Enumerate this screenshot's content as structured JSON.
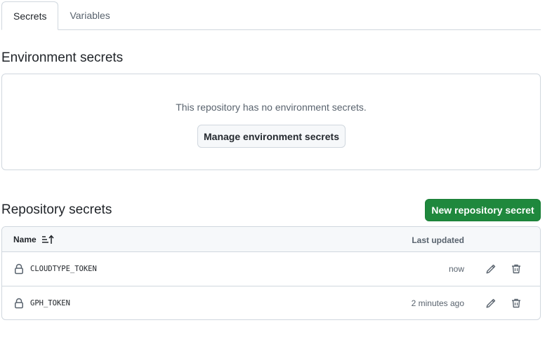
{
  "tabs": [
    {
      "label": "Secrets",
      "active": true
    },
    {
      "label": "Variables",
      "active": false
    }
  ],
  "environment": {
    "title": "Environment secrets",
    "empty_message": "This repository has no environment secrets.",
    "manage_button": "Manage environment secrets"
  },
  "repository": {
    "title": "Repository secrets",
    "new_button": "New repository secret",
    "columns": {
      "name": "Name",
      "updated": "Last updated"
    },
    "secrets": [
      {
        "name": "CLOUDTYPE_TOKEN",
        "updated": "now"
      },
      {
        "name": "GPH_TOKEN",
        "updated": "2 minutes ago"
      }
    ]
  },
  "colors": {
    "primary_button": "#1f883d",
    "border": "#d0d7de",
    "muted_text": "#59636e"
  },
  "icons": [
    "sort-icon",
    "lock-icon",
    "pencil-icon",
    "trash-icon"
  ]
}
